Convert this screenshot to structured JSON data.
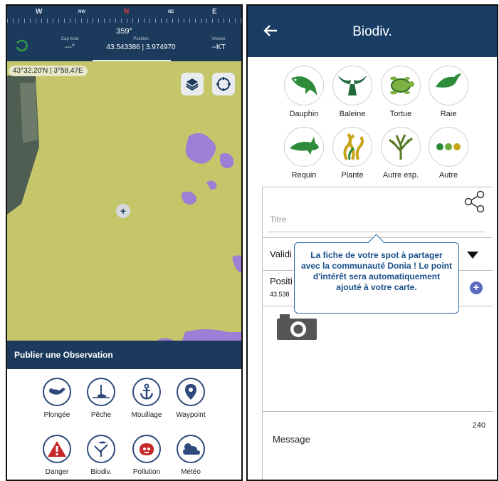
{
  "left_app": {
    "compass": {
      "labels": [
        "W",
        "NW",
        "N",
        "NE",
        "E"
      ],
      "heading": "359°"
    },
    "stats": {
      "cap_fond_label": "Cap fond",
      "cap_fond_value": "---°",
      "position_label": "Position",
      "position_value": "43.543386 | 3.974970",
      "vitesse_label": "Vitesse",
      "vitesse_value": "--KT"
    },
    "map": {
      "coord_chip": "43°32.20'N | 3°58.47E",
      "layers_icon": "layers-icon",
      "locate_icon": "crosshair-icon"
    },
    "publish_title": "Publier une Observation",
    "observations": [
      {
        "label": "Plongée",
        "icon": "diver-icon"
      },
      {
        "label": "Pêche",
        "icon": "fish-hook-icon"
      },
      {
        "label": "Mouillage",
        "icon": "anchor-icon"
      },
      {
        "label": "Waypoint",
        "icon": "pin-icon"
      },
      {
        "label": "Danger",
        "icon": "warning-icon"
      },
      {
        "label": "Biodiv.",
        "icon": "coral-fish-icon"
      },
      {
        "label": "Pollution",
        "icon": "pollution-icon"
      },
      {
        "label": "Météo",
        "icon": "weather-icon"
      }
    ],
    "colors": {
      "header": "#1b3a5c",
      "land": "#c5c56a",
      "accent": "#2e4a7d",
      "red": "#c62828"
    }
  },
  "right_app": {
    "header_title": "Biodiv.",
    "back_icon": "arrow-left-icon",
    "species": [
      {
        "label": "Dauphin",
        "icon": "dolphin-icon"
      },
      {
        "label": "Baleine",
        "icon": "whale-tail-icon"
      },
      {
        "label": "Tortue",
        "icon": "turtle-icon"
      },
      {
        "label": "Raie",
        "icon": "ray-icon"
      },
      {
        "label": "Requin",
        "icon": "shark-icon"
      },
      {
        "label": "Plante",
        "icon": "seaweed-icon"
      },
      {
        "label": "Autre esp.",
        "icon": "coral-icon"
      },
      {
        "label": "Autre",
        "icon": "dots-icon"
      }
    ],
    "form": {
      "titre_placeholder": "Titre",
      "validity_label": "Validi",
      "position_label": "Positi",
      "position_value": "43.538",
      "char_count": "240",
      "message_label": "Message"
    },
    "tooltip": "La fiche de votre spot à partager avec la communauté Donia ! Le point d'intérêt sera automatiquement ajouté à votre carte.",
    "colors": {
      "header": "#1a3d66",
      "species_green": "#2e8b3a",
      "tooltip_text": "#1a4f8a"
    }
  }
}
